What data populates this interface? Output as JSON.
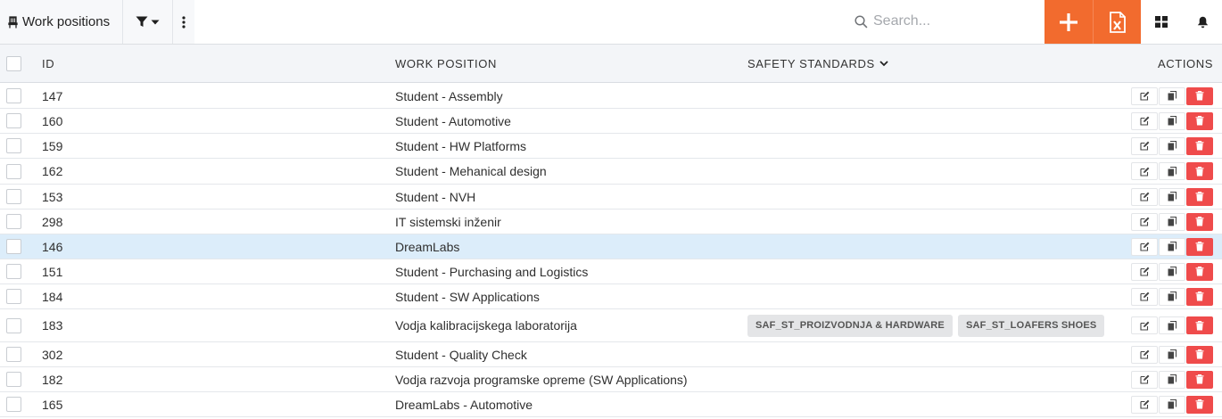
{
  "toolbar": {
    "title": "Work positions",
    "search_placeholder": "Search...",
    "colors": {
      "accent": "#f26b2e",
      "danger": "#ef4b4b",
      "selected_row": "#dcedfa"
    },
    "icons": [
      "chair-icon",
      "filter-icon",
      "caret-down-icon",
      "kebab-menu-icon",
      "search-icon",
      "plus-icon",
      "excel-export-icon",
      "grid-layout-icon",
      "bell-icon"
    ]
  },
  "table": {
    "headers": {
      "id": "ID",
      "work_position": "WORK POSITION",
      "safety_standards": "SAFETY STANDARDS",
      "actions": "ACTIONS"
    },
    "rows": [
      {
        "id": "147",
        "name": "Student - Assembly",
        "standards": []
      },
      {
        "id": "160",
        "name": "Student - Automotive",
        "standards": []
      },
      {
        "id": "159",
        "name": "Student - HW Platforms",
        "standards": []
      },
      {
        "id": "162",
        "name": "Student - Mehanical design",
        "standards": []
      },
      {
        "id": "153",
        "name": "Student - NVH",
        "standards": []
      },
      {
        "id": "298",
        "name": "IT sistemski inženir",
        "standards": []
      },
      {
        "id": "146",
        "name": "DreamLabs",
        "standards": [],
        "selected": true
      },
      {
        "id": "151",
        "name": "Student - Purchasing and Logistics",
        "standards": []
      },
      {
        "id": "184",
        "name": "Student - SW Applications",
        "standards": []
      },
      {
        "id": "183",
        "name": "Vodja kalibracijskega laboratorija",
        "standards": [
          "SAF_ST_PROIZVODNJA & HARDWARE",
          "SAF_ST_LOAFERS SHOES"
        ]
      },
      {
        "id": "302",
        "name": "Student - Quality Check",
        "standards": []
      },
      {
        "id": "182",
        "name": "Vodja razvoja programske opreme (SW Applications)",
        "standards": []
      },
      {
        "id": "165",
        "name": "DreamLabs - Automotive",
        "standards": []
      }
    ]
  }
}
